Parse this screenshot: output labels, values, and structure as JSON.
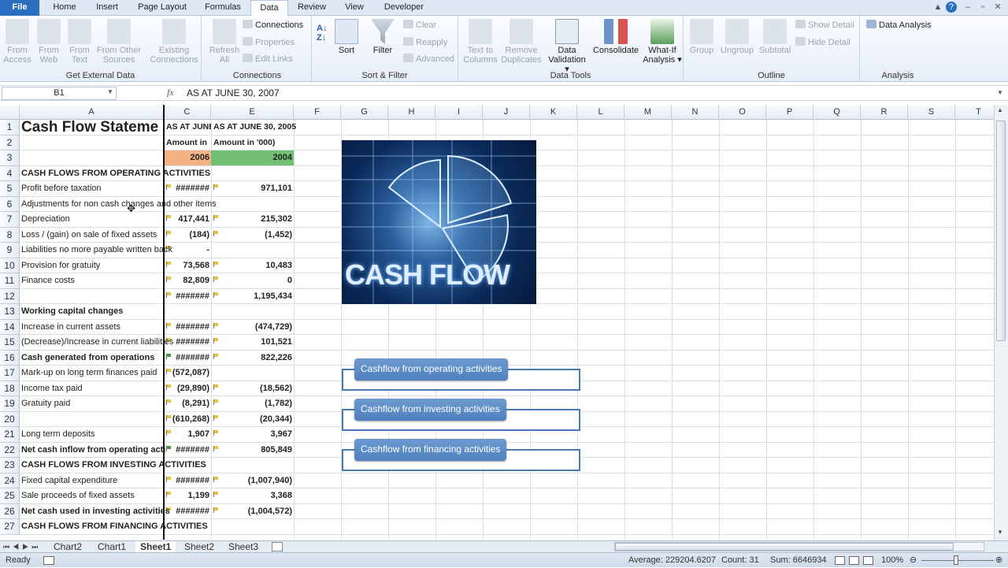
{
  "ribbon_tabs": [
    "File",
    "Home",
    "Insert",
    "Page Layout",
    "Formulas",
    "Data",
    "Review",
    "View",
    "Developer"
  ],
  "active_tab": "Data",
  "groups": {
    "get_external": {
      "label": "Get External Data",
      "buttons": [
        "From Access",
        "From Web",
        "From Text",
        "From Other Sources",
        "Existing Connections"
      ]
    },
    "connections": {
      "label": "Connections",
      "refresh": "Refresh All",
      "items": [
        "Connections",
        "Properties",
        "Edit Links"
      ]
    },
    "sortfilter": {
      "label": "Sort & Filter",
      "sort": "Sort",
      "filter": "Filter",
      "items": [
        "Clear",
        "Reapply",
        "Advanced"
      ]
    },
    "datatools": {
      "label": "Data Tools",
      "buttons": [
        "Text to Columns",
        "Remove Duplicates",
        "Data Validation",
        "Consolidate",
        "What-If Analysis"
      ]
    },
    "outline": {
      "label": "Outline",
      "buttons": [
        "Group",
        "Ungroup",
        "Subtotal"
      ],
      "items": [
        "Show Detail",
        "Hide Detail"
      ]
    },
    "analysis": {
      "label": "Analysis",
      "item": "Data Analysis"
    }
  },
  "formula_bar": {
    "name_box": "B1",
    "fx": "fx",
    "value": "AS AT JUNE 30, 2007"
  },
  "columns": [
    "A",
    "C",
    "E",
    "F",
    "G",
    "H",
    "I",
    "J",
    "K",
    "L",
    "M",
    "N",
    "O",
    "P",
    "Q",
    "R",
    "S",
    "T"
  ],
  "rows": [
    {
      "n": "1",
      "a": "Cash Flow Stateme",
      "c": "AS AT JUNE",
      "e": "AS AT JUNE 30, 2005",
      "style": "title"
    },
    {
      "n": "2",
      "a": "",
      "c": "Amount in",
      "e": "Amount in '000)",
      "style": "hdr"
    },
    {
      "n": "3",
      "a": "",
      "c": "2006",
      "e": "2004",
      "style": "year"
    },
    {
      "n": "4",
      "a": "CASH FLOWS FROM OPERATING ACTIVITIES",
      "c": "",
      "e": "",
      "style": "bold"
    },
    {
      "n": "5",
      "a": "Profit before taxation",
      "c": "#######",
      "e": "971,101"
    },
    {
      "n": "6",
      "a": "Adjustments for non cash changes and other items",
      "c": "",
      "e": ""
    },
    {
      "n": "7",
      "a": "Depreciation",
      "c": "417,441",
      "e": "215,302"
    },
    {
      "n": "8",
      "a": "Loss / (gain) on sale of fixed assets",
      "c": "(184)",
      "e": "(1,452)"
    },
    {
      "n": "9",
      "a": "Liabilities no more payable written back",
      "c": "-",
      "e": ""
    },
    {
      "n": "10",
      "a": "Provision for gratuity",
      "c": "73,568",
      "e": "10,483"
    },
    {
      "n": "11",
      "a": "Finance costs",
      "c": "82,809",
      "e": "0"
    },
    {
      "n": "12",
      "a": "",
      "c": "#######",
      "e": "1,195,434"
    },
    {
      "n": "13",
      "a": "Working capital changes",
      "c": "",
      "e": "",
      "style": "bold"
    },
    {
      "n": "14",
      "a": "Increase in current assets",
      "c": "#######",
      "e": "(474,729)"
    },
    {
      "n": "15",
      "a": "(Decrease)/Increase in current liabilities",
      "c": "#######",
      "e": "101,521"
    },
    {
      "n": "16",
      "a": "Cash generated from operations",
      "c": "#######",
      "e": "822,226",
      "style": "bold"
    },
    {
      "n": "17",
      "a": "Mark-up on long term finances paid",
      "c": "(572,087)",
      "e": ""
    },
    {
      "n": "18",
      "a": "Income tax paid",
      "c": "(29,890)",
      "e": "(18,562)"
    },
    {
      "n": "19",
      "a": "Gratuity paid",
      "c": "(8,291)",
      "e": "(1,782)"
    },
    {
      "n": "20",
      "a": "",
      "c": "(610,268)",
      "e": "(20,344)"
    },
    {
      "n": "21",
      "a": "Long term deposits",
      "c": "1,907",
      "e": "3,967"
    },
    {
      "n": "22",
      "a": "Net cash inflow from operating acti",
      "c": "#######",
      "e": "805,849",
      "style": "bold"
    },
    {
      "n": "23",
      "a": "CASH FLOWS FROM INVESTING ACTIVITIES",
      "c": "",
      "e": "",
      "style": "bold"
    },
    {
      "n": "24",
      "a": "Fixed capital expenditure",
      "c": "#######",
      "e": "(1,007,940)"
    },
    {
      "n": "25",
      "a": "Sale proceeds of fixed assets",
      "c": "1,199",
      "e": "3,368"
    },
    {
      "n": "26",
      "a": "Net cash used in investing activities",
      "c": "#######",
      "e": "(1,004,572)",
      "style": "bold"
    },
    {
      "n": "27",
      "a": "CASH FLOWS FROM FINANCING ACTIVITIES",
      "c": "",
      "e": "",
      "style": "bold"
    }
  ],
  "image_text": "CASH FLOW",
  "smartart": [
    "Cashflow from operating activities",
    "Cashflow from investing activities",
    "Cashflow from financing activities"
  ],
  "sheet_tabs": [
    "Chart2",
    "Chart1",
    "Sheet1",
    "Sheet2",
    "Sheet3"
  ],
  "active_sheet": "Sheet1",
  "status": {
    "mode": "Ready",
    "average": "Average: 229204.6207",
    "count": "Count: 31",
    "sum": "Sum: 6646934",
    "zoom": "100%"
  },
  "colors": {
    "year_c": "#f4b183",
    "year_e": "#70bf73",
    "accent": "#4f80bd"
  }
}
